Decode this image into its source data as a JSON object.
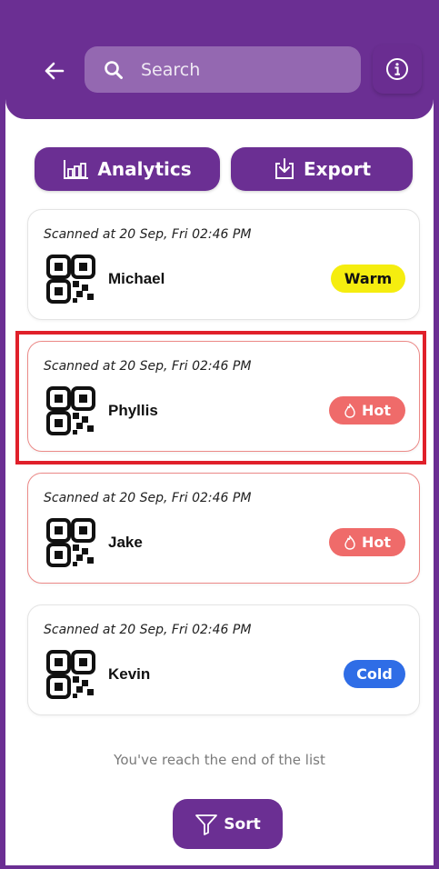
{
  "header": {
    "search_placeholder": "Search"
  },
  "actions": {
    "analytics_label": "Analytics",
    "export_label": "Export"
  },
  "cards": [
    {
      "scanned": "Scanned at 20 Sep, Fri 02:46 PM",
      "name": "Michael",
      "status": "Warm"
    },
    {
      "scanned": "Scanned at 20 Sep, Fri 02:46 PM",
      "name": "Phyllis",
      "status": "Hot"
    },
    {
      "scanned": "Scanned at 20 Sep, Fri 02:46 PM",
      "name": "Jake",
      "status": "Hot"
    },
    {
      "scanned": "Scanned at 20 Sep, Fri 02:46 PM",
      "name": "Kevin",
      "status": "Cold"
    }
  ],
  "footer": {
    "end_note": "You've reach the end of the list",
    "sort_label": "Sort"
  },
  "colors": {
    "brand_purple": "#6b2f93",
    "warm": "#f5ed0f",
    "hot": "#ef6b6a",
    "cold": "#2f6de6",
    "highlight": "#e0202a"
  },
  "icons": {
    "back": "arrow-left-icon",
    "search": "search-icon",
    "info": "info-icon",
    "analytics": "bar-chart-icon",
    "export": "download-icon",
    "qr": "qr-code-icon",
    "hot": "flame-icon",
    "sort": "filter-icon"
  }
}
